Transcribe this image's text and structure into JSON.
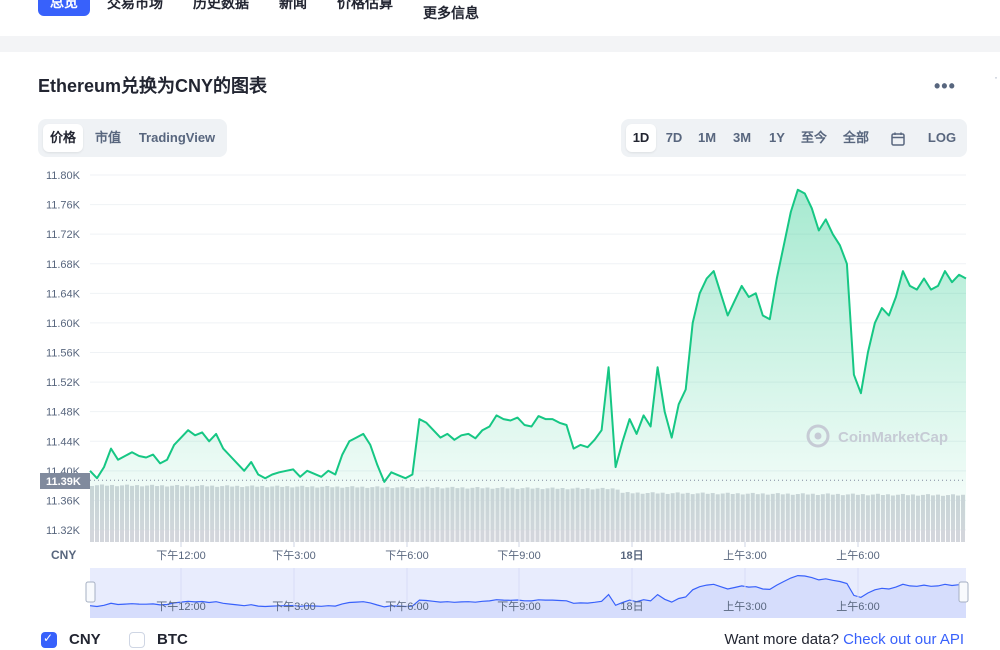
{
  "nav": {
    "tabs": [
      {
        "label": "总览",
        "active": true
      },
      {
        "label": "交易市场"
      },
      {
        "label": "历史数据"
      },
      {
        "label": "新闻"
      },
      {
        "label": "价格估算"
      },
      {
        "label": "更多信息"
      }
    ]
  },
  "card": {
    "title": "Ethereum兑换为CNY的图表",
    "more_icon": "more-horizontal-icon"
  },
  "chart_tabs": [
    "价格",
    "市值",
    "TradingView"
  ],
  "range_tabs": [
    "1D",
    "7D",
    "1M",
    "3M",
    "1Y",
    "至今",
    "全部"
  ],
  "range_active": "1D",
  "calendar_icon": "calendar-icon",
  "log_label": "LOG",
  "watermark": "CoinMarketCap",
  "chart_data": {
    "type": "area",
    "currency_label": "CNY",
    "y_ticks": [
      "11.80K",
      "11.76K",
      "11.72K",
      "11.68K",
      "11.64K",
      "11.60K",
      "11.56K",
      "11.52K",
      "11.48K",
      "11.44K",
      "11.40K",
      "11.36K",
      "11.32K"
    ],
    "ylim": [
      11320,
      11800
    ],
    "current_price_label": "11.39K",
    "current_price": 11390,
    "x_ticks": [
      "下午12:00",
      "下午3:00",
      "下午6:00",
      "下午9:00",
      "18日",
      "上午3:00",
      "上午6:00"
    ],
    "series": [
      {
        "values": [
          11400,
          11390,
          11405,
          11430,
          11415,
          11420,
          11425,
          11420,
          11418,
          11422,
          11410,
          11415,
          11435,
          11445,
          11455,
          11448,
          11452,
          11440,
          11450,
          11430,
          11420,
          11410,
          11400,
          11412,
          11395,
          11390,
          11395,
          11398,
          11400,
          11402,
          11392,
          11400,
          11396,
          11392,
          11400,
          11395,
          11422,
          11440,
          11445,
          11450,
          11435,
          11408,
          11385,
          11398,
          11394,
          11390,
          11395,
          11470,
          11465,
          11455,
          11445,
          11450,
          11442,
          11448,
          11450,
          11444,
          11455,
          11460,
          11475,
          11470,
          11468,
          11472,
          11462,
          11460,
          11474,
          11470,
          11470,
          11465,
          11462,
          11430,
          11435,
          11432,
          11442,
          11455,
          11540,
          11405,
          11440,
          11470,
          11450,
          11475,
          11460,
          11540,
          11480,
          11445,
          11490,
          11510,
          11600,
          11640,
          11660,
          11670,
          11640,
          11610,
          11630,
          11650,
          11635,
          11640,
          11610,
          11605,
          11660,
          11705,
          11750,
          11780,
          11775,
          11755,
          11725,
          11740,
          11720,
          11705,
          11680,
          11530,
          11505,
          11560,
          11600,
          11620,
          11610,
          11635,
          11670,
          11650,
          11645,
          11660,
          11645,
          11650,
          11670,
          11655,
          11665,
          11660
        ]
      }
    ],
    "volume_series_label": "volume"
  },
  "navigator_x_ticks": [
    "下午12:00",
    "下午3:00",
    "下午6:00",
    "下午9:00",
    "18日",
    "上午3:00",
    "上午6:00"
  ],
  "legend": {
    "cny_label": "CNY",
    "btc_label": "BTC",
    "api_prefix": "Want more data?",
    "api_link": "Check out our API"
  },
  "colors": {
    "accent": "#3861fb",
    "line": "#16c784",
    "area_top": "#16c784",
    "volume": "#c3c7cf",
    "navigator_bg": "#e8ecfd",
    "navigator_line": "#3861fb"
  }
}
